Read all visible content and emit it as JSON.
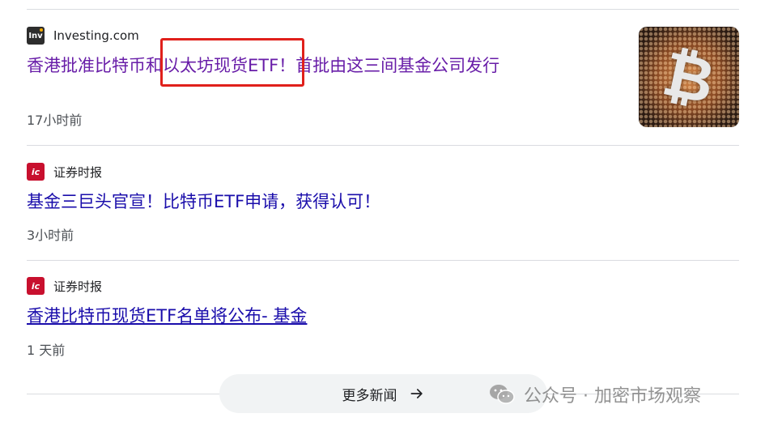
{
  "results": [
    {
      "source": "Investing.com",
      "favicon_text": "Inv",
      "headline": "香港批准比特币和以太坊现货ETF！首批由这三间基金公司发行",
      "time": "17小时前"
    },
    {
      "source": "证券时报",
      "favicon_text": "ic",
      "headline": "基金三巨头官宣！比特币ETF申请，获得认可！",
      "time": "3小时前"
    },
    {
      "source": "证券时报",
      "favicon_text": "ic",
      "headline": "香港比特币现货ETF名单将公布- 基金",
      "time": "1 天前"
    }
  ],
  "thumbnail": {
    "symbol": "₿"
  },
  "more_news": {
    "label": "更多新闻",
    "icon": "arrow-right-icon"
  },
  "watermark": {
    "text": "公众号 · 加密市场观察",
    "icon": "wechat-icon"
  },
  "colors": {
    "visited_link": "#681da8",
    "link": "#1a0dab",
    "highlight": "#e0201b"
  }
}
